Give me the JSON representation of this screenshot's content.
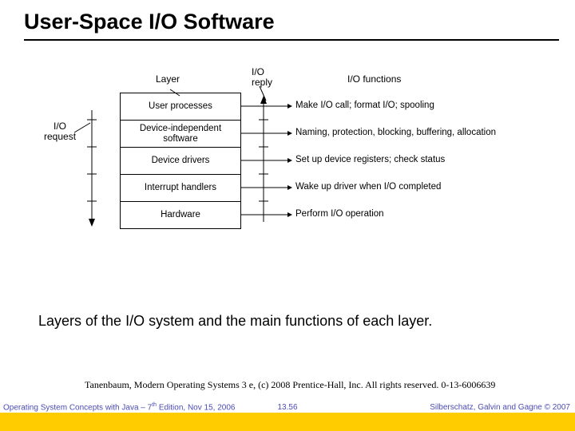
{
  "title": "User-Space I/O Software",
  "diagram": {
    "hdr_layer": "Layer",
    "hdr_reply": "I/O\nreply",
    "hdr_functions": "I/O functions",
    "lbl_request": "I/O\nrequest",
    "layers": {
      "l0": "User processes",
      "l1": "Device-independent\nsoftware",
      "l2": "Device drivers",
      "l3": "Interrupt handlers",
      "l4": "Hardware"
    },
    "fn": {
      "f0": "Make I/O call; format I/O; spooling",
      "f1": "Naming, protection, blocking, buffering, allocation",
      "f2": "Set up device registers; check status",
      "f3": "Wake up driver when I/O completed",
      "f4": "Perform I/O operation"
    }
  },
  "caption": "Layers of the I/O system and the main functions of each layer.",
  "cite": "Tanenbaum, Modern Operating Systems 3 e, (c) 2008 Prentice-Hall, Inc. All rights reserved. 0-13-6006639",
  "footer": {
    "left_a": "Operating System Concepts with Java – 7",
    "left_sup": "th",
    "left_b": " Edition, Nov 15, 2006",
    "center": "13.56",
    "right": "Silberschatz, Galvin and Gagne © 2007"
  }
}
